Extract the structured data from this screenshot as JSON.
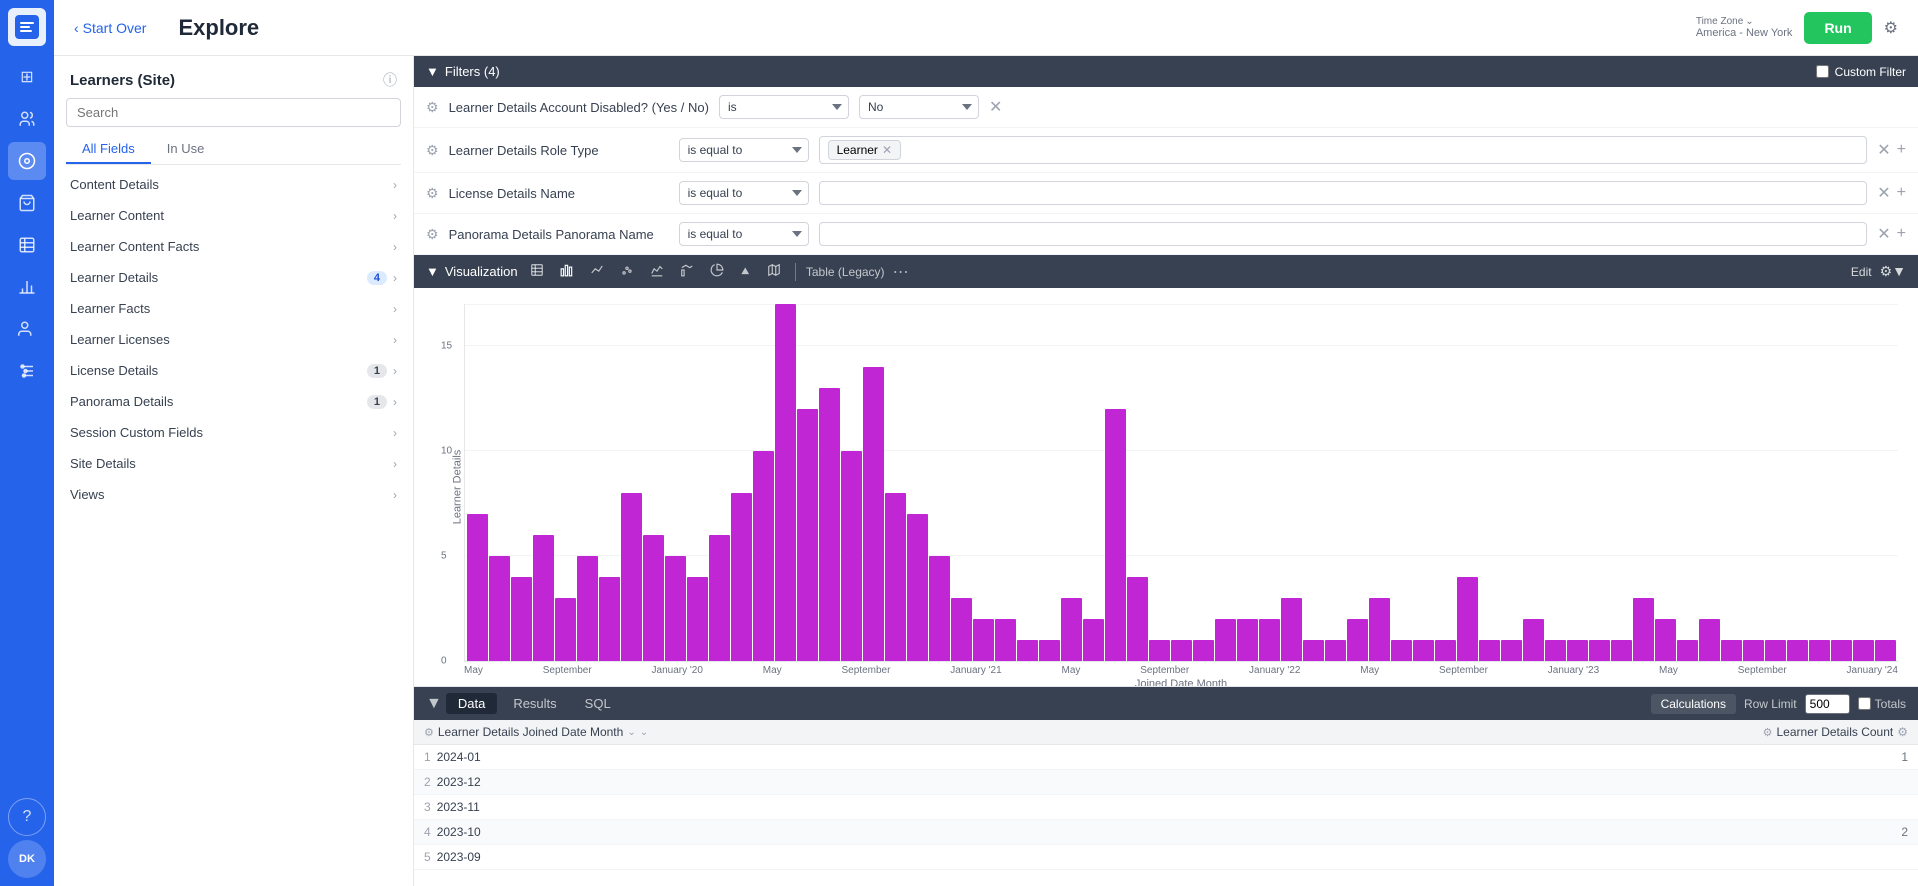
{
  "app": {
    "title": "Explore",
    "back_label": "Start Over",
    "timezone_label": "Time Zone",
    "timezone_value": "America - New York",
    "run_button": "Run"
  },
  "sidebar": {
    "logo_icon": "T",
    "icons": [
      {
        "name": "grid-icon",
        "symbol": "⊞",
        "active": false
      },
      {
        "name": "users-icon",
        "symbol": "👥",
        "active": false
      },
      {
        "name": "explore-icon",
        "symbol": "◎",
        "active": true
      },
      {
        "name": "cart-icon",
        "symbol": "🛒",
        "active": false
      },
      {
        "name": "table-icon",
        "symbol": "⊟",
        "active": false
      },
      {
        "name": "chart-icon",
        "symbol": "📊",
        "active": false
      },
      {
        "name": "people-icon",
        "symbol": "👤",
        "active": false
      },
      {
        "name": "sliders-icon",
        "symbol": "⚙",
        "active": false
      }
    ],
    "bottom_icons": [
      {
        "name": "help-icon",
        "symbol": "?"
      },
      {
        "name": "avatar-icon",
        "symbol": "DK"
      }
    ]
  },
  "left_panel": {
    "title": "Learners (Site)",
    "search_placeholder": "Search",
    "tabs": [
      {
        "label": "All Fields",
        "active": true
      },
      {
        "label": "In Use",
        "active": false
      }
    ],
    "fields": [
      {
        "label": "Content Details",
        "badge": null
      },
      {
        "label": "Learner Content",
        "badge": null
      },
      {
        "label": "Learner Content Facts",
        "badge": null
      },
      {
        "label": "Learner Details",
        "badge": "4"
      },
      {
        "label": "Learner Facts",
        "badge": null
      },
      {
        "label": "Learner Licenses",
        "badge": null
      },
      {
        "label": "License Details",
        "badge": "1"
      },
      {
        "label": "Panorama Details",
        "badge": "1"
      },
      {
        "label": "Session Custom Fields",
        "badge": null
      },
      {
        "label": "Site Details",
        "badge": null
      },
      {
        "label": "Views",
        "badge": null
      }
    ]
  },
  "filters": {
    "section_title": "Filters (4)",
    "custom_filter_label": "Custom Filter",
    "rows": [
      {
        "name": "Learner Details Account Disabled? (Yes / No)",
        "operator": "is",
        "value_type": "select",
        "value": "No"
      },
      {
        "name": "Learner Details Role Type",
        "operator": "is equal to",
        "value_type": "tag",
        "value": "Learner"
      },
      {
        "name": "License Details Name",
        "operator": "is equal to",
        "value_type": "text",
        "value": ""
      },
      {
        "name": "Panorama Details Panorama Name",
        "operator": "is equal to",
        "value_type": "text",
        "value": ""
      }
    ]
  },
  "visualization": {
    "section_title": "Visualization",
    "table_label": "Table (Legacy)",
    "edit_label": "Edit",
    "y_axis_label": "Learner Details",
    "x_axis_label": "Joined Date Month",
    "y_ticks": [
      0,
      5,
      10,
      15
    ],
    "bars": [
      7,
      5,
      4,
      6,
      3,
      5,
      4,
      8,
      6,
      5,
      4,
      6,
      8,
      10,
      17,
      12,
      13,
      10,
      14,
      8,
      7,
      5,
      3,
      2,
      2,
      1,
      1,
      3,
      2,
      12,
      4,
      1,
      1,
      1,
      2,
      2,
      2,
      3,
      1,
      1,
      2,
      3,
      1,
      1,
      1,
      4,
      1,
      1,
      2,
      1,
      1,
      1,
      1,
      3,
      2,
      1,
      2,
      1,
      1,
      1,
      1,
      1,
      1,
      1,
      1
    ],
    "x_labels": [
      "May",
      "September",
      "January '20",
      "May",
      "September",
      "January '21",
      "May",
      "September",
      "January '22",
      "May",
      "September",
      "January '23",
      "May",
      "September",
      "January '24"
    ]
  },
  "data_section": {
    "tabs": [
      {
        "label": "Data",
        "active": true
      },
      {
        "label": "Results",
        "active": false
      },
      {
        "label": "SQL",
        "active": false
      }
    ],
    "calculations_label": "Calculations",
    "row_limit_label": "Row Limit",
    "row_limit_value": "500",
    "totals_label": "Totals",
    "columns": [
      {
        "label": "Learner Details Joined Date Month",
        "key": "joined_date"
      },
      {
        "label": "Learner Details Count",
        "key": "count"
      }
    ],
    "rows": [
      {
        "num": 1,
        "joined_date": "2024-01",
        "count": "1"
      },
      {
        "num": 2,
        "joined_date": "2023-12",
        "count": ""
      },
      {
        "num": 3,
        "joined_date": "2023-11",
        "count": ""
      },
      {
        "num": 4,
        "joined_date": "2023-10",
        "count": "2"
      },
      {
        "num": 5,
        "joined_date": "2023-09",
        "count": ""
      }
    ]
  }
}
